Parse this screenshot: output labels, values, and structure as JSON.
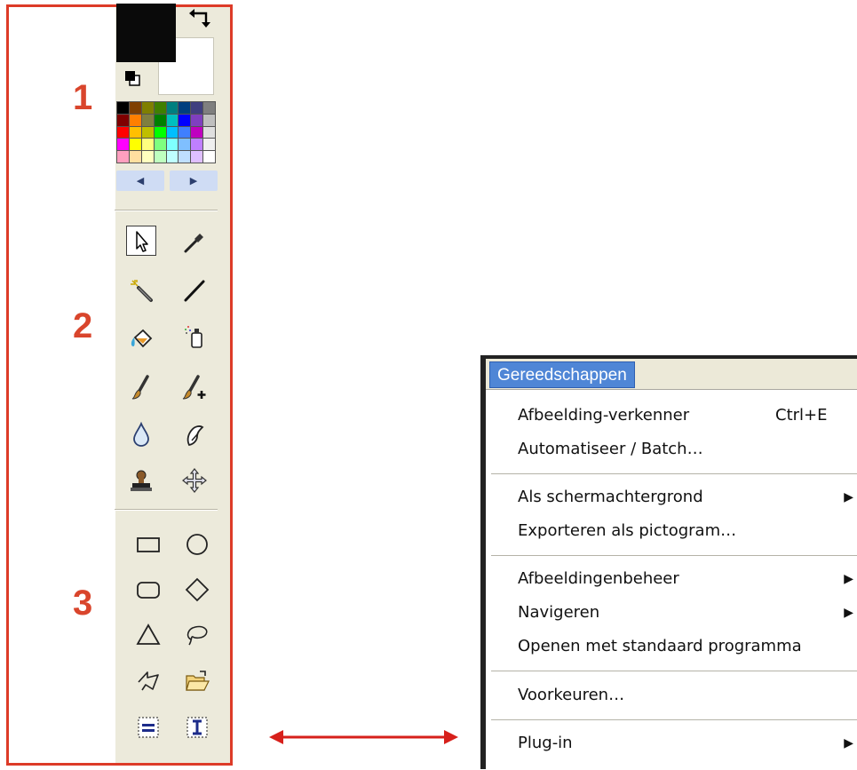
{
  "markers": [
    "1",
    "2",
    "3"
  ],
  "palette_colors": [
    "#000000",
    "#7f3f00",
    "#7f7f00",
    "#3f7f00",
    "#007f7f",
    "#003f7f",
    "#3f3f7f",
    "#7f7f7f",
    "#7f0000",
    "#ff7f00",
    "#7f7f3f",
    "#007f00",
    "#00bfbf",
    "#0000ff",
    "#7f3fbf",
    "#bfbfbf",
    "#ff0000",
    "#ffbf00",
    "#bfbf00",
    "#00ff00",
    "#00bfff",
    "#3f7fff",
    "#bf00bf",
    "#dfdfdf",
    "#ff00ff",
    "#ffff00",
    "#ffff7f",
    "#7fff7f",
    "#7fffff",
    "#7fbfff",
    "#bf7fff",
    "#efefef",
    "#ff9fbf",
    "#ffdf9f",
    "#ffffbf",
    "#bfffbf",
    "#bfffff",
    "#bfdfff",
    "#dfbfff",
    "#ffffff"
  ],
  "colors": {
    "foreground": "#0a0a0a",
    "background": "#ffffff",
    "accent": "#dd3b28",
    "menu_highlight": "#4f86d6"
  },
  "toolbox": {
    "tools": [
      {
        "name": "select-icon",
        "active": true
      },
      {
        "name": "eyedropper-icon"
      },
      {
        "name": "magic-wand-icon"
      },
      {
        "name": "line-icon"
      },
      {
        "name": "fill-bucket-icon"
      },
      {
        "name": "spray-can-icon"
      },
      {
        "name": "brush-icon"
      },
      {
        "name": "brush-plus-icon"
      },
      {
        "name": "drop-icon"
      },
      {
        "name": "smudge-icon"
      },
      {
        "name": "stamp-icon"
      },
      {
        "name": "move-icon"
      },
      {
        "name": "rectangle-icon"
      },
      {
        "name": "ellipse-icon"
      },
      {
        "name": "rounded-rect-icon"
      },
      {
        "name": "diamond-icon"
      },
      {
        "name": "triangle-icon"
      },
      {
        "name": "lasso-icon"
      },
      {
        "name": "polygon-lasso-icon"
      },
      {
        "name": "open-folder-icon"
      },
      {
        "name": "horizontal-text-icon"
      },
      {
        "name": "vertical-text-icon"
      }
    ]
  },
  "menu": {
    "title": "Gereedschappen",
    "items": [
      {
        "label": "Afbeelding-verkenner",
        "shortcut": "Ctrl+E"
      },
      {
        "label": "Automatiseer / Batch…"
      },
      {
        "label": "Als schermachtergrond",
        "submenu": true
      },
      {
        "label": "Exporteren als pictogram…"
      },
      {
        "label": "Afbeeldingenbeheer",
        "submenu": true
      },
      {
        "label": "Navigeren",
        "submenu": true
      },
      {
        "label": "Openen met standaard programma"
      },
      {
        "label": "Voorkeuren…"
      },
      {
        "label": "Plug-in",
        "submenu": true
      }
    ]
  }
}
